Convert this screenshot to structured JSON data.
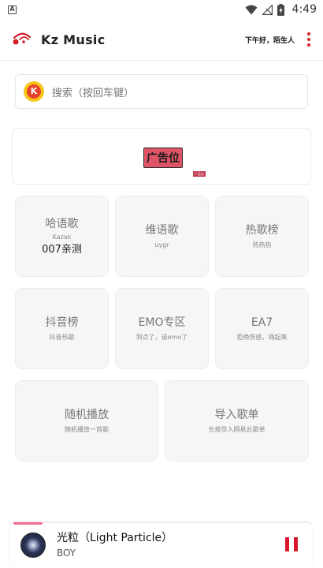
{
  "status_bar": {
    "notification_icon": "A",
    "icons": [
      "wifi-icon",
      "signal-off-icon",
      "battery-charging-icon"
    ],
    "time": "4:49"
  },
  "header": {
    "logo_icon": "swirl-logo-icon",
    "title": "Kz Music",
    "greeting": "下午好，陌生人",
    "more_icon": "more-vertical-icon",
    "accent_color": "#d32027"
  },
  "search": {
    "logo_text": "K",
    "placeholder": "搜索（按回车键）"
  },
  "ad": {
    "label": "广告位",
    "tiny_text": "广告位"
  },
  "tiles": [
    {
      "title": "哈语歌",
      "subtitle": "Kazak",
      "extra": "007亲测"
    },
    {
      "title": "维语歌",
      "subtitle": "uygr"
    },
    {
      "title": "热歌榜",
      "subtitle": "热热热"
    },
    {
      "title": "抖音榜",
      "subtitle": "抖音热歌"
    },
    {
      "title": "EMO专区",
      "subtitle": "到点了，该emo了"
    },
    {
      "title": "EA7",
      "subtitle": "拒绝伤感，嗨起来"
    },
    {
      "title": "随机播放",
      "subtitle": "随机播放一首歌"
    },
    {
      "title": "导入歌单",
      "subtitle": "长按导入网易云歌单"
    }
  ],
  "player": {
    "title": "光粒（Light Particle）",
    "artist": "BOY",
    "pause_icon": "pause-icon",
    "pause_color": "#d8182a"
  }
}
